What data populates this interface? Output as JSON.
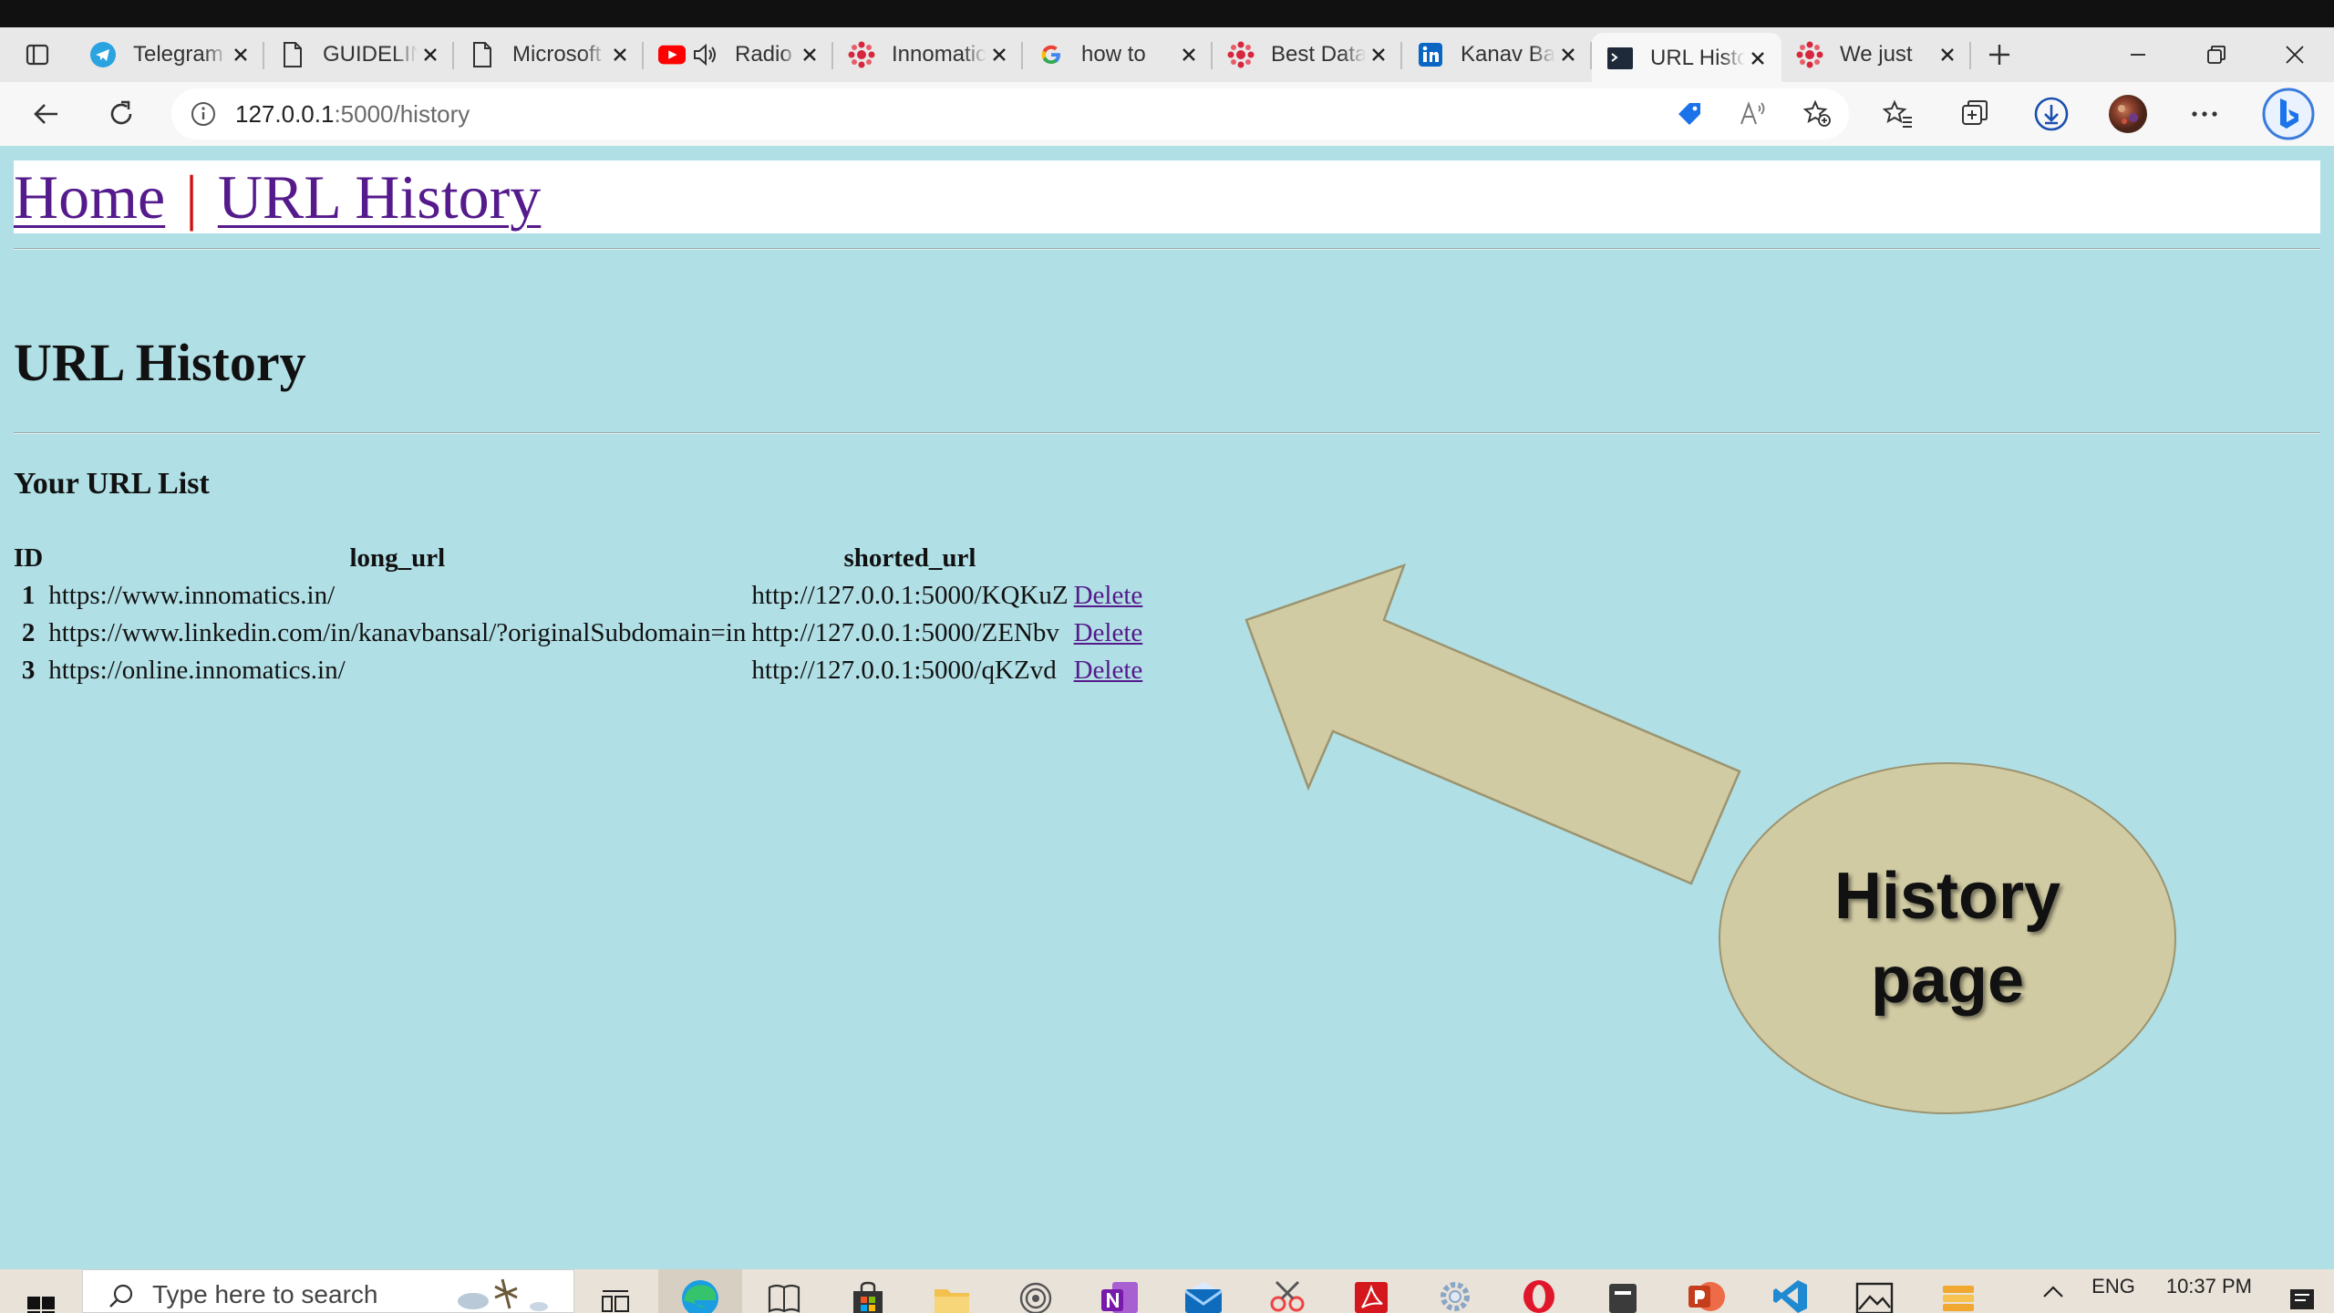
{
  "browser": {
    "tabs": [
      {
        "title": "Telegram",
        "favicon": "telegram-icon",
        "active": false
      },
      {
        "title": "GUIDELINES",
        "favicon": "document-icon",
        "active": false
      },
      {
        "title": "Microsoft",
        "favicon": "document-icon",
        "active": false
      },
      {
        "title": "Radio",
        "favicon": "youtube-icon",
        "active": false
      },
      {
        "title": "Innomatics",
        "favicon": "innomatics-icon",
        "active": false
      },
      {
        "title": "how to",
        "favicon": "google-icon",
        "active": false
      },
      {
        "title": "Best Data",
        "favicon": "innomatics-icon",
        "active": false
      },
      {
        "title": "Kanav Bansal",
        "favicon": "linkedin-icon",
        "active": false
      },
      {
        "title": "URL History",
        "favicon": "terminal-icon",
        "active": true
      },
      {
        "title": "We just",
        "favicon": "innomatics-icon",
        "active": false
      }
    ],
    "address": {
      "host": "127.0.0.1",
      "path": ":5000/history"
    }
  },
  "page": {
    "nav": {
      "home_label": "Home",
      "separator": "|",
      "history_label": "URL History"
    },
    "title": "URL History",
    "list_title": "Your URL List",
    "table": {
      "headers": [
        "ID",
        "long_url",
        "shorted_url",
        ""
      ],
      "rows": [
        {
          "id": "1",
          "long_url": "https://www.innomatics.in/",
          "short_url": "http://127.0.0.1:5000/KQKuZ",
          "action": "Delete"
        },
        {
          "id": "2",
          "long_url": "https://www.linkedin.com/in/kanavbansal/?originalSubdomain=in",
          "short_url": "http://127.0.0.1:5000/ZENbv",
          "action": "Delete"
        },
        {
          "id": "3",
          "long_url": "https://online.innomatics.in/",
          "short_url": "http://127.0.0.1:5000/qKZvd",
          "action": "Delete"
        }
      ]
    }
  },
  "annotation": {
    "text": "History\npage",
    "color": "#d1cba3"
  },
  "taskbar": {
    "search_placeholder": "Type here to search",
    "lang": "ENG",
    "time": "10:37 PM"
  },
  "colors": {
    "page_bg": "#b0dfe5",
    "link": "#551a8b",
    "nav_separator": "#d01010"
  }
}
